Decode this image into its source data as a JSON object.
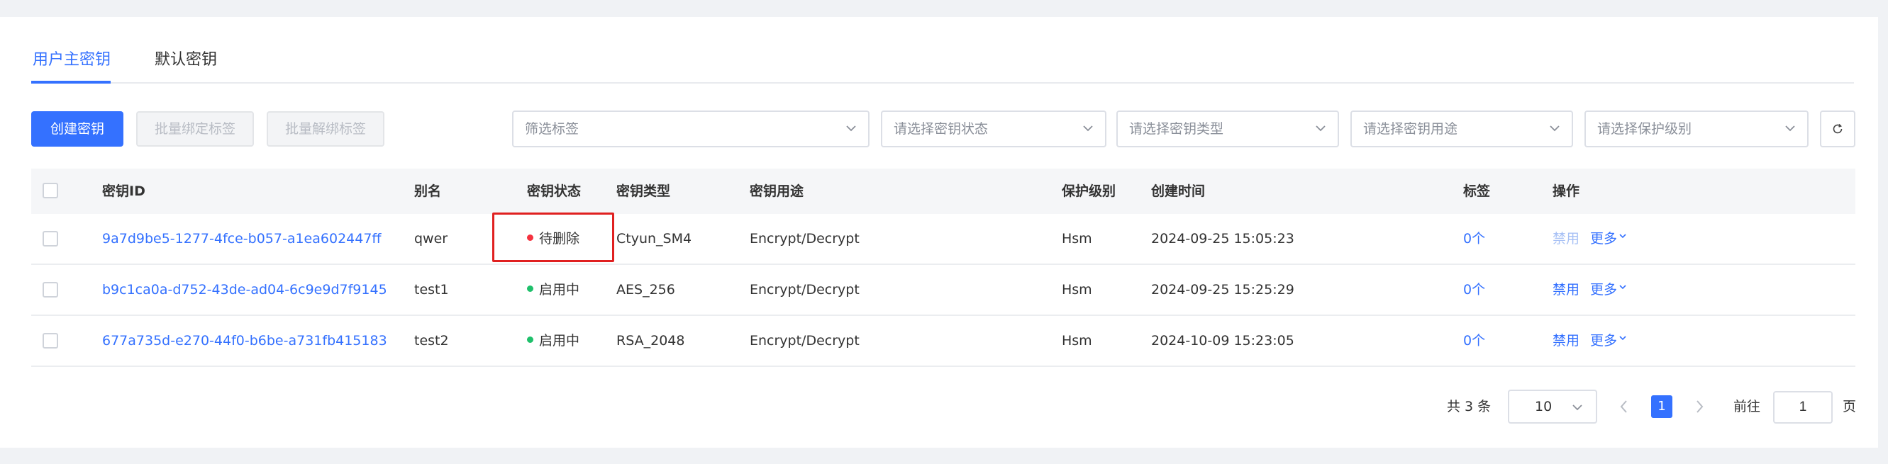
{
  "tabs": [
    {
      "label": "用户主密钥",
      "active": true
    },
    {
      "label": "默认密钥",
      "active": false
    }
  ],
  "toolbar": {
    "create_label": "创建密钥",
    "bind_tags_label": "批量绑定标签",
    "unbind_tags_label": "批量解绑标签"
  },
  "filters": {
    "tag": "筛选标签",
    "status": "请选择密钥状态",
    "type": "请选择密钥类型",
    "usage": "请选择密钥用途",
    "protection": "请选择保护级别"
  },
  "table": {
    "headers": {
      "key_id": "密钥ID",
      "alias": "别名",
      "status": "密钥状态",
      "type": "密钥类型",
      "usage": "密钥用途",
      "protection": "保护级别",
      "created": "创建时间",
      "tags": "标签",
      "actions": "操作"
    },
    "rows": [
      {
        "key_id": "9a7d9be5-1277-4fce-b057-a1ea602447ff",
        "alias": "qwer",
        "status": "待删除",
        "status_color": "#f5323f",
        "type": "Ctyun_SM4",
        "usage": "Encrypt/Decrypt",
        "protection": "Hsm",
        "created": "2024-09-25 15:05:23",
        "tags": "0个",
        "action_disable": "禁用",
        "action_more": "更多"
      },
      {
        "key_id": "b9c1ca0a-d752-43de-ad04-6c9e9d7f9145",
        "alias": "test1",
        "status": "启用中",
        "status_color": "#1fc06b",
        "type": "AES_256",
        "usage": "Encrypt/Decrypt",
        "protection": "Hsm",
        "created": "2024-09-25 15:25:29",
        "tags": "0个",
        "action_disable": "禁用",
        "action_more": "更多"
      },
      {
        "key_id": "677a735d-e270-44f0-b6be-a731fb415183",
        "alias": "test2",
        "status": "启用中",
        "status_color": "#1fc06b",
        "type": "RSA_2048",
        "usage": "Encrypt/Decrypt",
        "protection": "Hsm",
        "created": "2024-10-09 15:23:05",
        "tags": "0个",
        "action_disable": "禁用",
        "action_more": "更多"
      }
    ]
  },
  "pagination": {
    "total_label": "共 3 条",
    "page_size": "10",
    "current_page": "1",
    "goto_label": "前往",
    "goto_value": "1",
    "page_suffix": "页"
  },
  "colors": {
    "accent": "#3471ff",
    "highlight_border": "#e02020"
  }
}
